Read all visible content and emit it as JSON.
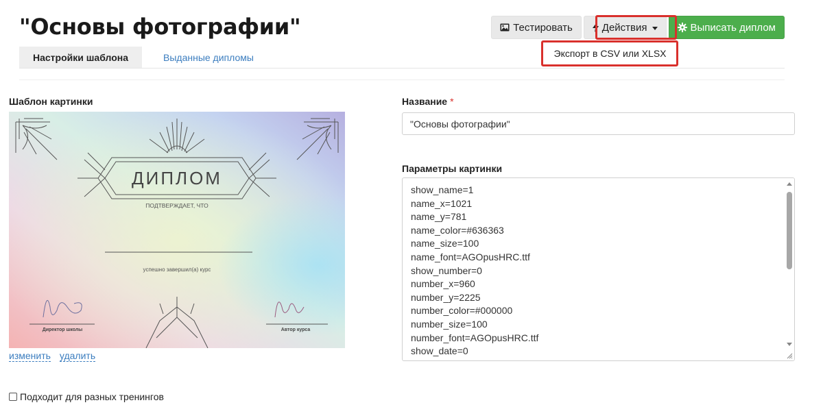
{
  "page": {
    "title": "\"Основы фотографии\""
  },
  "toolbar": {
    "test_label": "Тестировать",
    "actions_label": "Действия",
    "issue_label": "Выписать диплом",
    "icons": {
      "test": "image-icon",
      "actions": "bolt-icon",
      "issue": "gear-icon"
    }
  },
  "dropdown": {
    "items": [
      {
        "label": "Экспорт в CSV или XLSX"
      }
    ]
  },
  "highlight_color": "#d9302c",
  "tabs": [
    {
      "label": "Настройки шаблона",
      "active": true
    },
    {
      "label": "Выданные дипломы",
      "active": false
    }
  ],
  "image_template": {
    "label": "Шаблон картинки",
    "change_label": "изменить",
    "delete_label": "удалить",
    "preview": {
      "heading": "ДИПЛОМ",
      "subheading": "ПОДТВЕРЖДАЕТ, ЧТО",
      "course_line": "успешно завершил(а) курс",
      "signature_left": "Директор школы",
      "signature_right": "Автор курса"
    }
  },
  "name_field": {
    "label": "Название",
    "required_mark": "*",
    "value": "\"Основы фотографии\""
  },
  "params_field": {
    "label": "Параметры картинки",
    "lines": [
      "show_name=1",
      "name_x=1021",
      "name_y=781",
      "name_color=#636363",
      "name_size=100",
      "name_font=AGOpusHRC.ttf",
      "show_number=0",
      "number_x=960",
      "number_y=2225",
      "number_color=#000000",
      "number_size=100",
      "number_font=AGOpusHRC.ttf",
      "show_date=0"
    ]
  },
  "multi_training": {
    "label": "Подходит для разных тренингов",
    "checked": false
  },
  "colors": {
    "success": "#4cae4c",
    "link": "#3b7dbf"
  }
}
